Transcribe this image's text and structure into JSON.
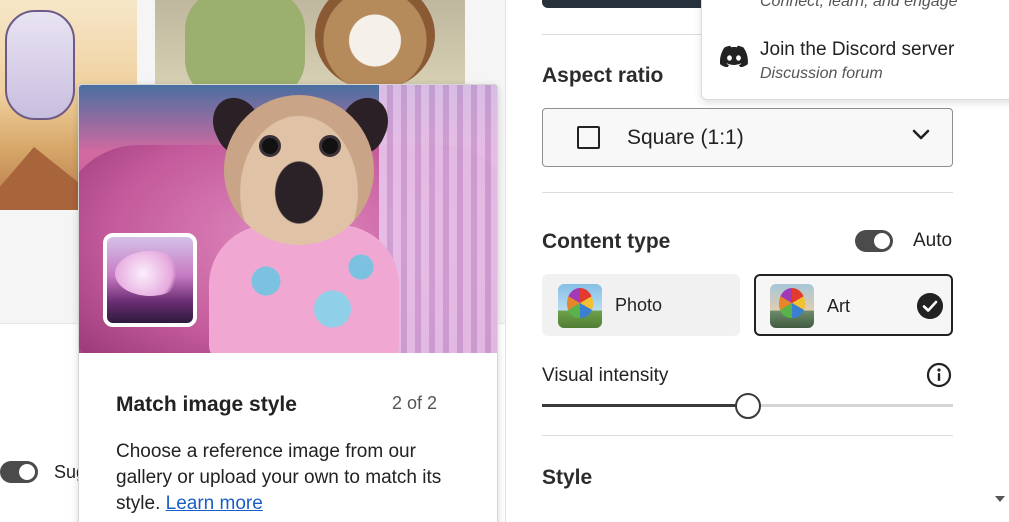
{
  "gallery": {
    "toggle_label": "Sug"
  },
  "popover": {
    "title": "Match image style",
    "counter": "2 of 2",
    "description": "Choose a reference image from our gallery or upload your own to match its style.",
    "link_text": "Learn more"
  },
  "side_panel": {
    "aspect_ratio": {
      "title": "Aspect ratio",
      "selected": "Square (1:1)"
    },
    "content_type": {
      "title": "Content type",
      "auto_label": "Auto",
      "auto_enabled": true,
      "options": [
        {
          "label": "Photo",
          "selected": false
        },
        {
          "label": "Art",
          "selected": true
        }
      ]
    },
    "visual_intensity": {
      "label": "Visual intensity",
      "value_fraction": 0.5
    },
    "style": {
      "title": "Style"
    }
  },
  "community_menu": {
    "partial_text": "Connect, learn, and engage",
    "discord_title": "Join the Discord server",
    "discord_subtitle": "Discussion forum"
  },
  "colors": {
    "accent_link": "#1a5fc7",
    "toggle_on": "#4b4b4b",
    "selected_border": "#222222"
  }
}
